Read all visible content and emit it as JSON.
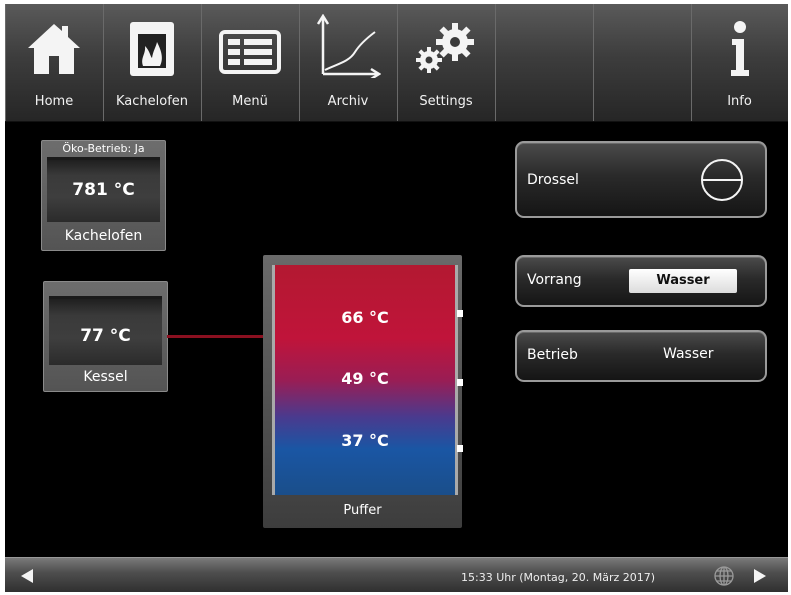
{
  "nav": {
    "items": [
      {
        "label": "Home",
        "icon": "home-icon"
      },
      {
        "label": "Kachelofen",
        "icon": "stove-icon"
      },
      {
        "label": "Menü",
        "icon": "menu-icon"
      },
      {
        "label": "Archiv",
        "icon": "chart-icon"
      },
      {
        "label": "Settings",
        "icon": "gears-icon"
      },
      {
        "label": "",
        "icon": ""
      },
      {
        "label": "",
        "icon": ""
      },
      {
        "label": "Info",
        "icon": "info-icon"
      }
    ]
  },
  "kachelofen": {
    "status": "Öko-Betrieb: Ja",
    "temperature": "781 °C",
    "label": "Kachelofen"
  },
  "kessel": {
    "temperature": "77 °C",
    "label": "Kessel"
  },
  "puffer": {
    "label": "Puffer",
    "temps": [
      "66 °C",
      "49 °C",
      "37 °C"
    ]
  },
  "controls": {
    "drossel": {
      "label": "Drossel",
      "icon": "throttle-valve-icon"
    },
    "vorrang": {
      "label": "Vorrang",
      "value": "Wasser"
    },
    "betrieb": {
      "label": "Betrieb",
      "value": "Wasser"
    }
  },
  "footer": {
    "datetime": "15:33 Uhr (Montag, 20. März 2017)"
  },
  "colors": {
    "background": "#000000",
    "tank_hot": "#c0143a",
    "tank_cold": "#1a56a4",
    "pipe": "#8b1020"
  }
}
